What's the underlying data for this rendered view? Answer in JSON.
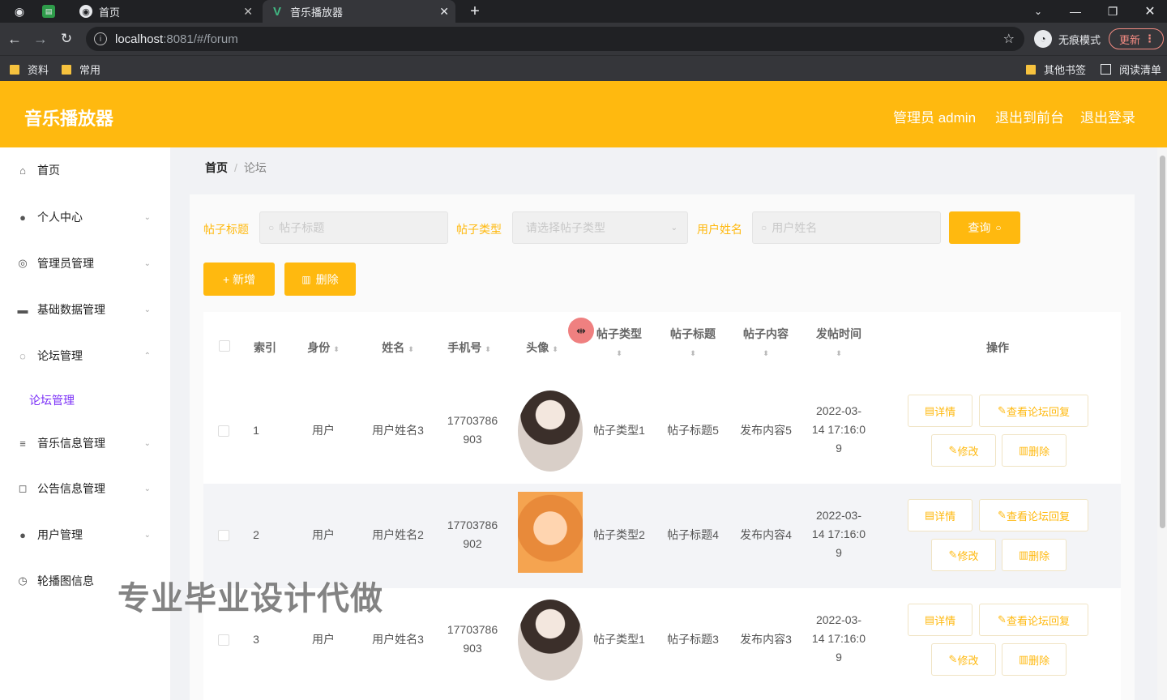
{
  "browser": {
    "tabs": [
      {
        "title": "首页"
      },
      {
        "title": "音乐播放器"
      }
    ],
    "url_host": "localhost",
    "url_path": ":8081/#/forum",
    "incognito_label": "无痕模式",
    "update_label": "更新",
    "bookmarks": [
      "资料",
      "常用"
    ],
    "other_bookmarks": "其他书签",
    "reading_list": "阅读清单"
  },
  "header": {
    "title": "音乐播放器",
    "user_label": "管理员 admin",
    "to_front_label": "退出到前台",
    "logout_label": "退出登录"
  },
  "sidebar": {
    "items": [
      {
        "label": "首页"
      },
      {
        "label": "个人中心"
      },
      {
        "label": "管理员管理"
      },
      {
        "label": "基础数据管理"
      },
      {
        "label": "论坛管理"
      },
      {
        "label": "音乐信息管理"
      },
      {
        "label": "公告信息管理"
      },
      {
        "label": "用户管理"
      },
      {
        "label": "轮播图信息"
      }
    ],
    "subitem": "论坛管理"
  },
  "breadcrumb": {
    "home": "首页",
    "current": "论坛"
  },
  "filters": {
    "title_label": "帖子标题",
    "title_placeholder": "帖子标题",
    "type_label": "帖子类型",
    "type_placeholder": "请选择帖子类型",
    "user_label": "用户姓名",
    "user_placeholder": "用户姓名",
    "search_label": "查询"
  },
  "actions": {
    "add_label": "+ 新增",
    "delete_label": "删除"
  },
  "table": {
    "headers": {
      "index": "索引",
      "identity": "身份",
      "name": "姓名",
      "phone": "手机号",
      "avatar": "头像",
      "post_type": "帖子类型",
      "post_title": "帖子标题",
      "post_content": "帖子内容",
      "post_time": "发帖时间",
      "operation": "操作"
    },
    "rows": [
      {
        "index": "1",
        "identity": "用户",
        "name": "用户姓名3",
        "phone_a": "17703786",
        "phone_b": "903",
        "post_type": "帖子类型1",
        "post_title": "帖子标题5",
        "post_content": "发布内容5",
        "time_a": "2022-03-",
        "time_b": "14 17:16:0",
        "time_c": "9"
      },
      {
        "index": "2",
        "identity": "用户",
        "name": "用户姓名2",
        "phone_a": "17703786",
        "phone_b": "902",
        "post_type": "帖子类型2",
        "post_title": "帖子标题4",
        "post_content": "发布内容4",
        "time_a": "2022-03-",
        "time_b": "14 17:16:0",
        "time_c": "9"
      },
      {
        "index": "3",
        "identity": "用户",
        "name": "用户姓名3",
        "phone_a": "17703786",
        "phone_b": "903",
        "post_type": "帖子类型1",
        "post_title": "帖子标题3",
        "post_content": "发布内容3",
        "time_a": "2022-03-",
        "time_b": "14 17:16:0",
        "time_c": "9"
      }
    ],
    "op_labels": {
      "detail": "详情",
      "view_replies": "查看论坛回复",
      "edit": "修改",
      "delete": "删除"
    }
  },
  "watermark": "专业毕业设计代做",
  "colors": {
    "accent": "#ffb90f",
    "submenu_active": "#7b2ff7"
  }
}
